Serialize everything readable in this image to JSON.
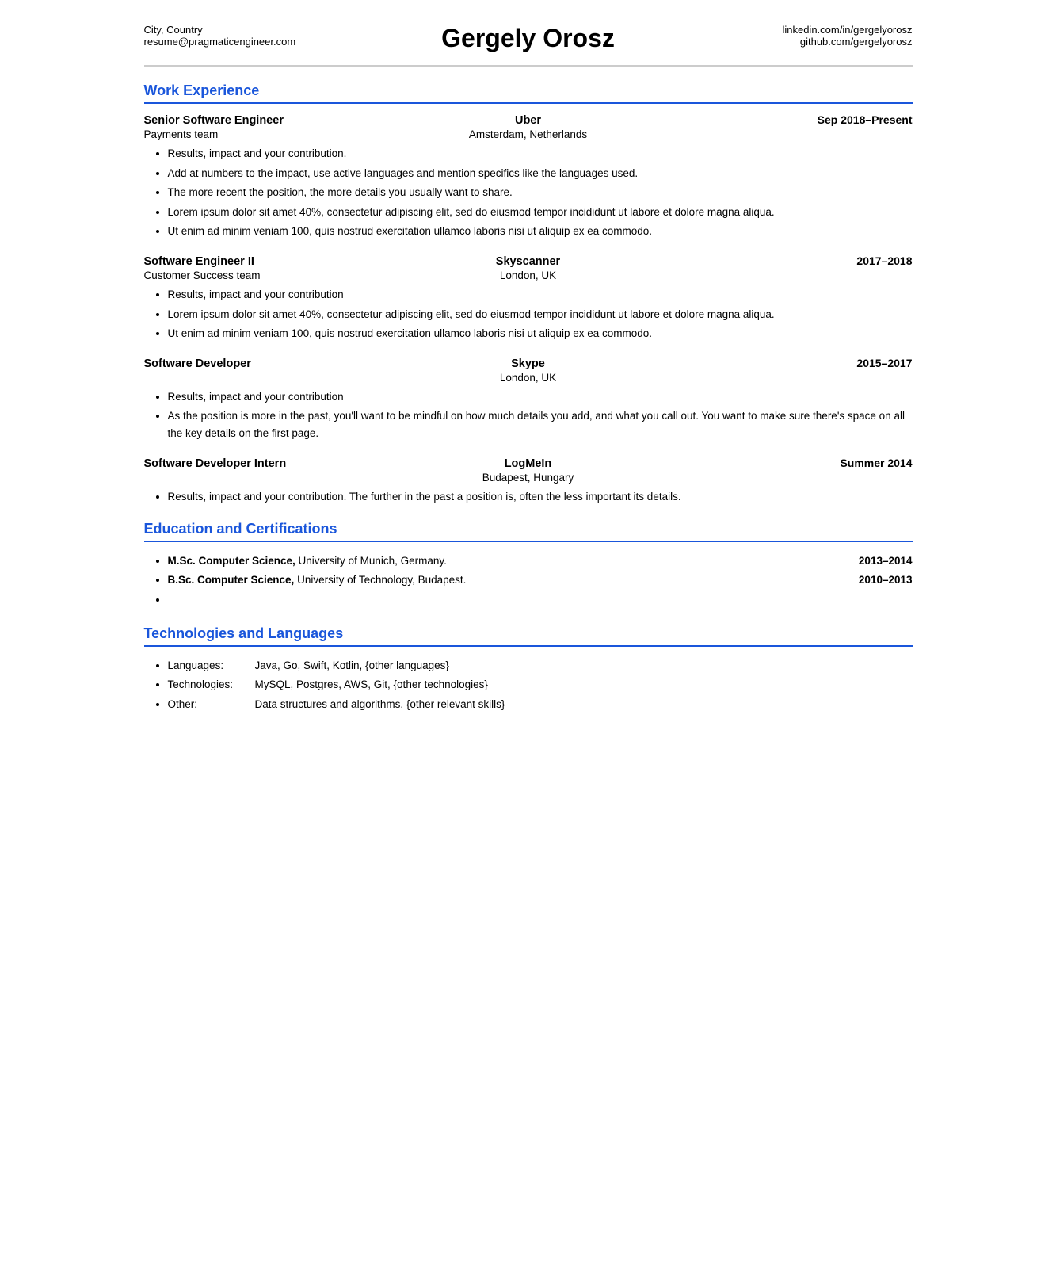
{
  "header": {
    "left": {
      "location": "City, Country",
      "email": "resume@pragmaticengineer.com"
    },
    "name": "Gergely Orosz",
    "right": {
      "linkedin": "linkedin.com/in/gergelyorosz",
      "github": "github.com/gergelyorosz"
    }
  },
  "sections": {
    "work_experience": {
      "title": "Work Experience",
      "jobs": [
        {
          "title": "Senior Software Engineer",
          "company": "Uber",
          "dates": "Sep 2018–Present",
          "team": "Payments team",
          "location": "Amsterdam, Netherlands",
          "bullets": [
            "Results, impact and your contribution.",
            "Add at numbers to the impact, use active languages and mention specifics like the languages used.",
            "The more recent the position, the more details you usually want to share.",
            "Lorem ipsum dolor sit amet 40%, consectetur adipiscing elit, sed do eiusmod tempor incididunt ut labore et dolore magna aliqua.",
            "Ut enim ad minim veniam 100, quis nostrud exercitation ullamco laboris nisi ut aliquip ex ea commodo."
          ]
        },
        {
          "title": "Software Engineer II",
          "company": "Skyscanner",
          "dates": "2017–2018",
          "team": "Customer Success team",
          "location": "London, UK",
          "bullets": [
            "Results, impact and your contribution",
            "Lorem ipsum dolor sit amet 40%, consectetur adipiscing elit, sed do eiusmod tempor incididunt ut labore et dolore magna aliqua.",
            "Ut enim ad minim veniam 100, quis nostrud exercitation ullamco laboris nisi ut aliquip ex ea commodo."
          ]
        },
        {
          "title": "Software Developer",
          "company": "Skype",
          "dates": "2015–2017",
          "team": "",
          "location": "London, UK",
          "bullets": [
            "Results, impact and your contribution",
            "As the position is more in the past, you'll want to be mindful on how much details you add, and what you call out. You want to make sure there's space on all the key details on the first page."
          ]
        },
        {
          "title": "Software Developer Intern",
          "company": "LogMeIn",
          "dates": "Summer 2014",
          "team": "",
          "location": "Budapest, Hungary",
          "bullets": [
            "Results, impact and your contribution. The further in the past a position is, often the less important its details."
          ]
        }
      ]
    },
    "education": {
      "title": "Education and Certifications",
      "items": [
        {
          "text_bold": "M.Sc. Computer Science,",
          "text_regular": " University of Munich, Germany.",
          "year": "2013–2014"
        },
        {
          "text_bold": "B.Sc. Computer Science,",
          "text_regular": " University of Technology, Budapest.",
          "year": "2010–2013"
        },
        {
          "text_bold": "",
          "text_regular": "",
          "year": ""
        }
      ]
    },
    "technologies": {
      "title": "Technologies and Languages",
      "items": [
        {
          "label": "Languages:",
          "value": "Java, Go, Swift, Kotlin, {other languages}"
        },
        {
          "label": "Technologies:",
          "value": "MySQL, Postgres, AWS, Git, {other technologies}"
        },
        {
          "label": "Other:",
          "value": "Data structures and algorithms, {other relevant skills}"
        }
      ]
    }
  }
}
